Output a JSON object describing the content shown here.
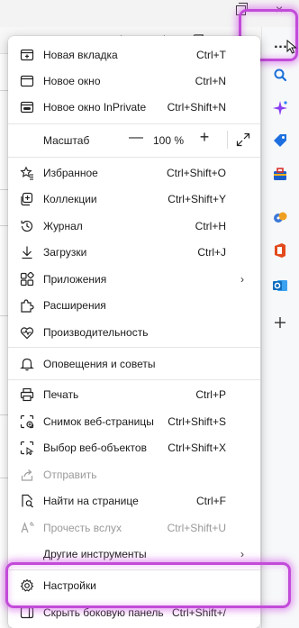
{
  "colors": {
    "highlight": "#c24bd9",
    "menu_bg": "#ffffff",
    "accent_blue": "#1a6fd8"
  },
  "topbar": {
    "more_button_label": "…",
    "close_glyph": "×"
  },
  "menu": {
    "items_top": [
      {
        "id": "new-tab",
        "label": "Новая вкладка",
        "shortcut": "Ctrl+T",
        "icon": "new-tab-icon"
      },
      {
        "id": "new-window",
        "label": "Новое окно",
        "shortcut": "Ctrl+N",
        "icon": "new-window-icon"
      },
      {
        "id": "inprivate",
        "label": "Новое окно InPrivate",
        "shortcut": "Ctrl+Shift+N",
        "icon": "inprivate-icon"
      }
    ],
    "zoom": {
      "label": "Масштаб",
      "value": "100 %",
      "minus": "—",
      "plus": "+"
    },
    "items_mid": [
      {
        "id": "favorites",
        "label": "Избранное",
        "shortcut": "Ctrl+Shift+O",
        "icon": "favorites-icon"
      },
      {
        "id": "collections",
        "label": "Коллекции",
        "shortcut": "Ctrl+Shift+Y",
        "icon": "collections-icon"
      },
      {
        "id": "history",
        "label": "Журнал",
        "shortcut": "Ctrl+H",
        "icon": "history-icon"
      },
      {
        "id": "downloads",
        "label": "Загрузки",
        "shortcut": "Ctrl+J",
        "icon": "download-icon"
      },
      {
        "id": "apps",
        "label": "Приложения",
        "shortcut": "",
        "icon": "apps-icon",
        "submenu": true
      },
      {
        "id": "extensions",
        "label": "Расширения",
        "shortcut": "",
        "icon": "extensions-icon"
      },
      {
        "id": "performance",
        "label": "Производительность",
        "shortcut": "",
        "icon": "performance-icon"
      }
    ],
    "items_alerts": [
      {
        "id": "alerts",
        "label": "Оповещения и советы",
        "shortcut": "",
        "icon": "bell-icon"
      }
    ],
    "items_tools": [
      {
        "id": "print",
        "label": "Печать",
        "shortcut": "Ctrl+P",
        "icon": "print-icon"
      },
      {
        "id": "screenshot",
        "label": "Снимок веб-страницы",
        "shortcut": "Ctrl+Shift+S",
        "icon": "screenshot-icon"
      },
      {
        "id": "web-select",
        "label": "Выбор веб-объектов",
        "shortcut": "Ctrl+Shift+X",
        "icon": "web-select-icon"
      },
      {
        "id": "share",
        "label": "Отправить",
        "shortcut": "",
        "icon": "share-icon",
        "disabled": true
      },
      {
        "id": "find",
        "label": "Найти на странице",
        "shortcut": "Ctrl+F",
        "icon": "find-icon"
      },
      {
        "id": "read-aloud",
        "label": "Прочесть вслух",
        "shortcut": "Ctrl+Shift+U",
        "icon": "read-aloud-icon",
        "disabled": true
      },
      {
        "id": "more-tools",
        "label": "Другие инструменты",
        "shortcut": "",
        "icon": "",
        "submenu": true
      }
    ],
    "items_bottom": [
      {
        "id": "settings",
        "label": "Настройки",
        "shortcut": "",
        "icon": "gear-icon"
      },
      {
        "id": "hide-sidebar",
        "label": "Скрыть боковую панель",
        "shortcut": "Ctrl+Shift+/",
        "icon": "sidebar-icon"
      }
    ]
  },
  "sidebar": {
    "icons": [
      "search-icon",
      "copilot-icon",
      "shopping-tag-icon",
      "tools-briefcase-icon",
      "games-icon",
      "office-icon",
      "outlook-icon",
      "add-icon"
    ]
  }
}
